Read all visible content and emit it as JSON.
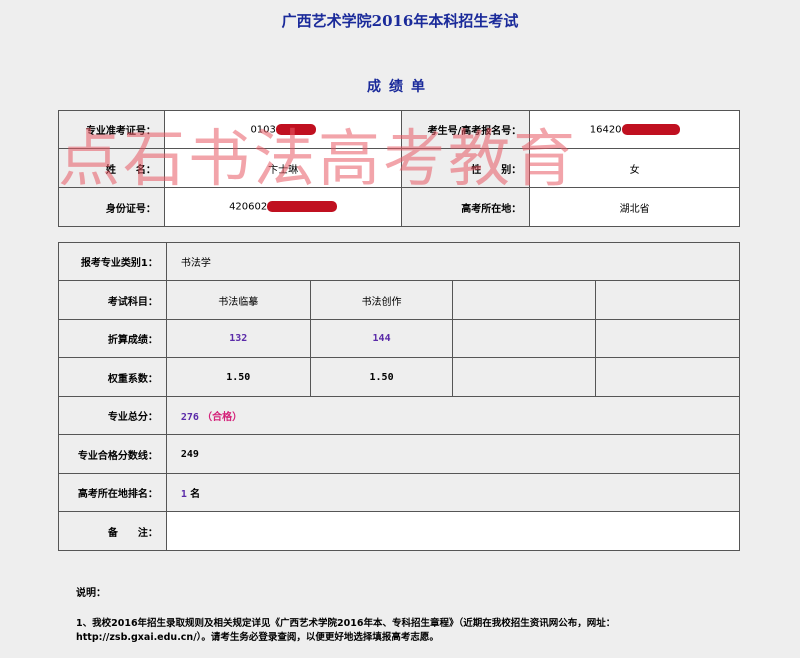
{
  "title": "广西艺术学院2016年本科招生考试",
  "subtitle": "成绩单",
  "info": {
    "exam_id_label": "专业准考证号：",
    "exam_id_value": "0103",
    "reg_no_label": "考生号/高考报名号：",
    "reg_no_value": "16420",
    "name_label": "姓　　名：",
    "name_value": "卞士琳",
    "gender_label": "性　　别：",
    "gender_value": "女",
    "id_label": "身份证号：",
    "id_value": "420602",
    "province_label": "高考所在地：",
    "province_value": "湖北省"
  },
  "scores": {
    "category_label": "报考专业类别1：",
    "category_value": "书法学",
    "subjects_label": "考试科目：",
    "subjects": [
      "书法临摹",
      "书法创作",
      "",
      ""
    ],
    "converted_label": "折算成绩：",
    "converted": [
      "132",
      "144",
      "",
      ""
    ],
    "weight_label": "权重系数：",
    "weights": [
      "1.50",
      "1.50",
      "",
      ""
    ],
    "total_label": "专业总分：",
    "total_value": "276",
    "total_status": "（合格）",
    "cutoff_label": "专业合格分数线：",
    "cutoff_value": "249",
    "rank_label": "高考所在地排名：",
    "rank_value": "1",
    "rank_unit": "名",
    "remark_label": "备　　注：",
    "remark_value": ""
  },
  "watermark": "点石书法高考教育",
  "notes": {
    "title": "说明：",
    "item1": "1、我校2016年招生录取规则及相关规定详见《广西艺术学院2016年本、专科招生章程》（近期在我校招生资讯网公布，网址：http://zsb.gxai.edu.cn/）。请考生务必登录查阅，以便更好地选择填报高考志愿。"
  },
  "colors": {
    "title": "#1a2a9a",
    "score": "#5a2aa8",
    "pass": "#d4227a",
    "watermark": "#e85a64",
    "redaction": "#c01020"
  }
}
